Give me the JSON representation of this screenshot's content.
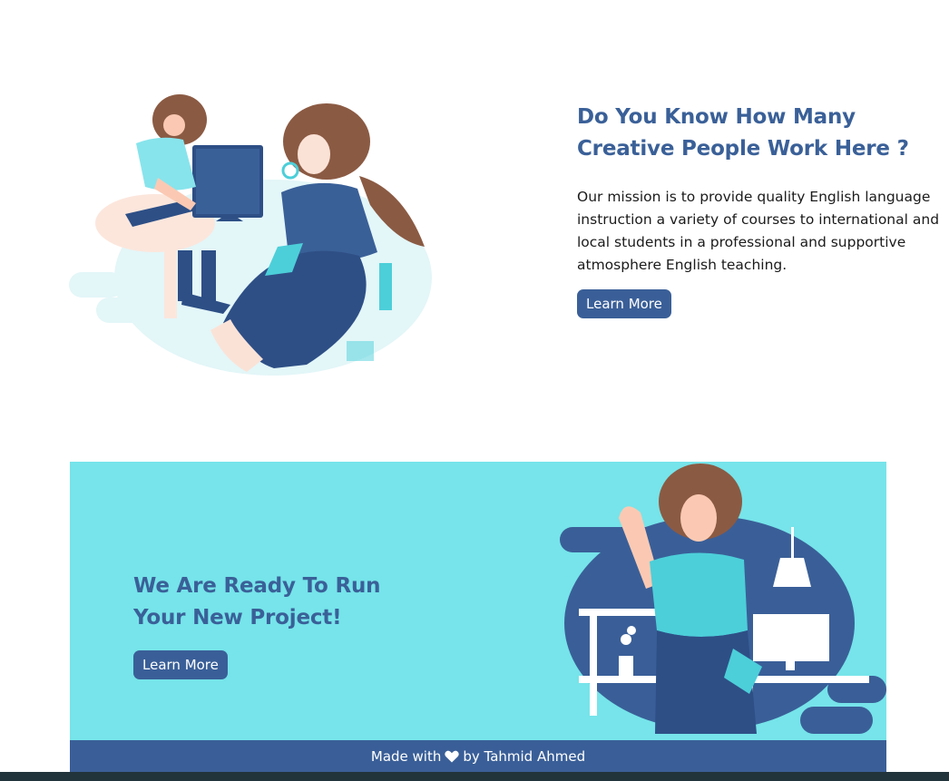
{
  "about": {
    "title_line1": "Do You Know How Many",
    "title_line2": "Creative People Work Here ?",
    "description": "Our mission is to provide quality English language instruction a variety of courses to international and local students in a professional and supportive atmosphere English teaching.",
    "button_label": "Learn More"
  },
  "project": {
    "title_line1": "We Are Ready To Run",
    "title_line2": "Your New Project!",
    "button_label": "Learn More"
  },
  "footer": {
    "text_before": "Made with",
    "icon": "heart-icon",
    "text_after": "by Tahmid Ahmed"
  },
  "colors": {
    "primary": "#3a5f98",
    "accent_bg": "#76e4ea",
    "heading": "#3a6098",
    "bottom_bar": "#22343b"
  }
}
